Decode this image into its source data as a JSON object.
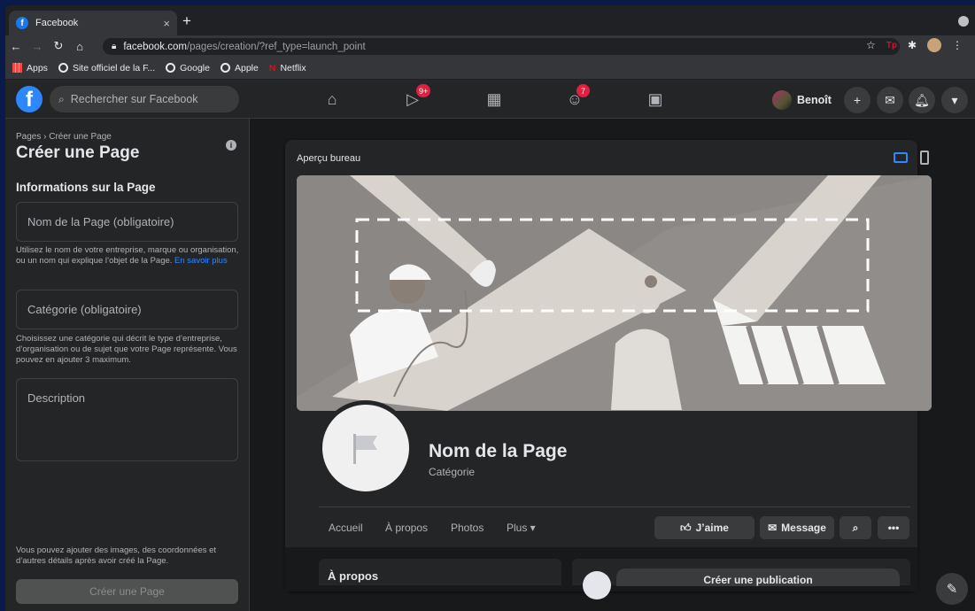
{
  "browser": {
    "tab_title": "Facebook",
    "url_host": "facebook.com",
    "url_path": "/pages/creation/?ref_type=launch_point",
    "bookmarks": [
      "Apps",
      "Site officiel de la F...",
      "Google",
      "Apple",
      "Netflix"
    ]
  },
  "fb": {
    "search_placeholder": "Rechercher sur Facebook",
    "badge_watch": "9+",
    "badge_groups": "7",
    "profile_name": "Benoît",
    "brand_color": "#2d88ff"
  },
  "left": {
    "breadcrumb": "Pages › Créer une Page",
    "title": "Créer une Page",
    "section": "Informations sur la Page",
    "name_placeholder": "Nom de la Page (obligatoire)",
    "name_help": "Utilisez le nom de votre entreprise, marque ou organisation, ou un nom qui explique l’objet de la Page.",
    "name_help_link": "En savoir plus",
    "category_placeholder": "Catégorie (obligatoire)",
    "category_help": "Choisissez une catégorie qui décrit le type d’entreprise, d’organisation ou de sujet que votre Page représente. Vous pouvez en ajouter 3 maximum.",
    "description_placeholder": "Description",
    "bottom_help": "Vous pouvez ajouter des images, des coordonnées et d’autres détails après avoir créé la Page.",
    "create_button": "Créer une Page"
  },
  "preview": {
    "label": "Aperçu bureau",
    "page_name": "Nom de la Page",
    "page_category": "Catégorie",
    "tabs": [
      "Accueil",
      "À propos",
      "Photos",
      "Plus ▾"
    ],
    "like_button": "J’aime",
    "message_button": "Message",
    "about_header": "À propos",
    "create_post": "Créer une publication"
  }
}
